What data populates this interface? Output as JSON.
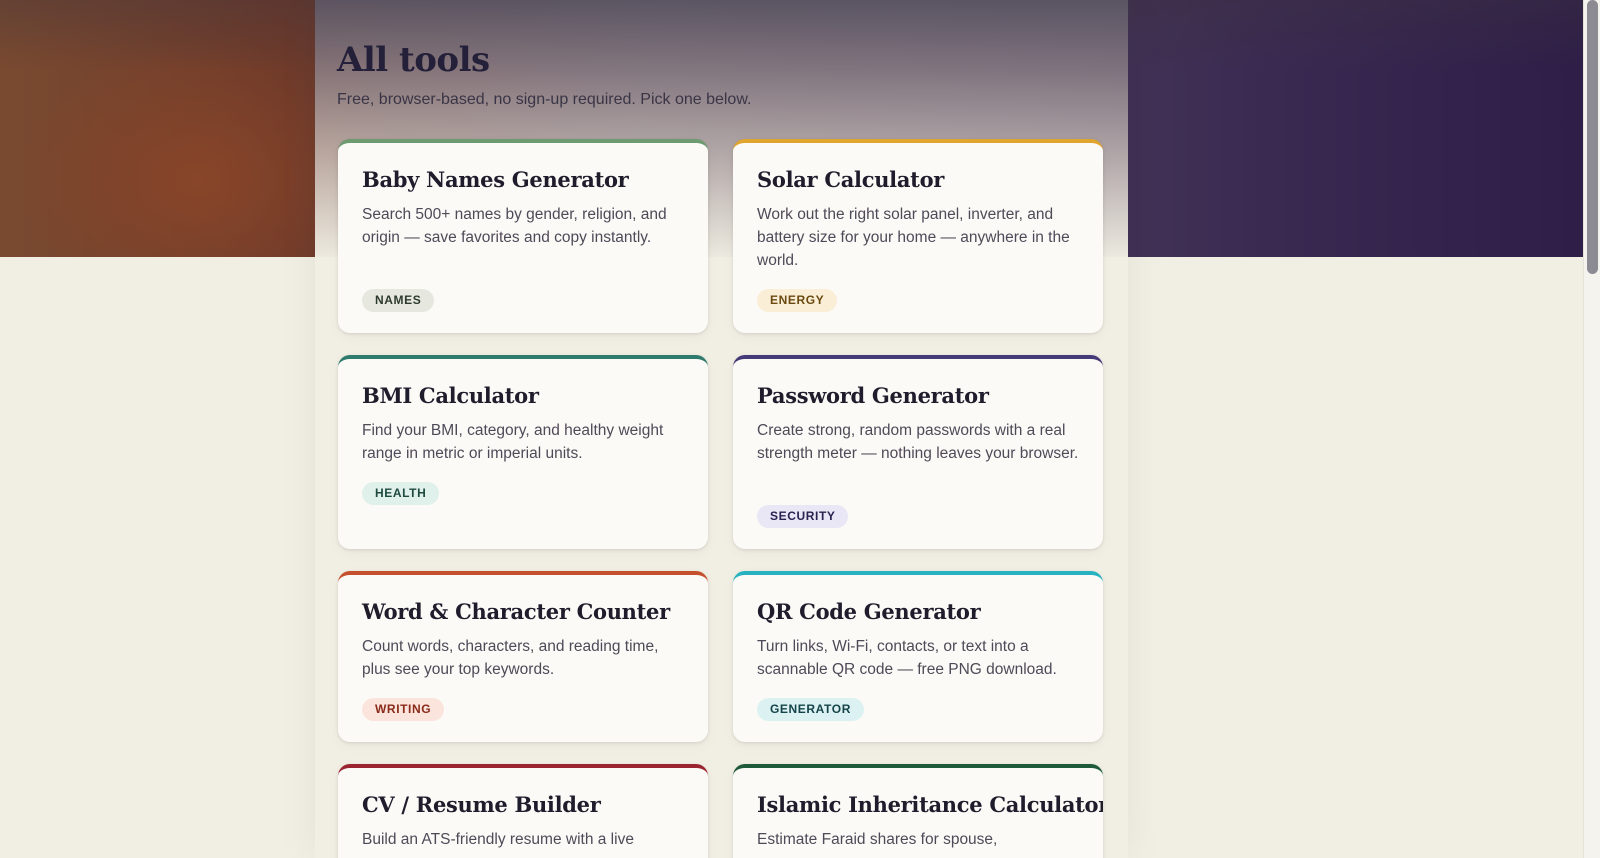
{
  "header": {
    "title": "All tools",
    "subtitle": "Free, browser-based, no sign-up required. Pick one below."
  },
  "tools": [
    {
      "title": "Baby Names Generator",
      "description": "Search 500+ names by gender, religion, and origin — save favorites and copy instantly.",
      "tag": "NAMES",
      "accent": "#6d9a70",
      "tag_bg": "#e6e8e0",
      "tag_color": "#2e3a2e"
    },
    {
      "title": "Solar Calculator",
      "description": "Work out the right solar panel, inverter, and battery size for your home — anywhere in the world.",
      "tag": "ENERGY",
      "accent": "#e0a52e",
      "tag_bg": "#fbeed6",
      "tag_color": "#6a4a10"
    },
    {
      "title": "BMI Calculator",
      "description": "Find your BMI, category, and healthy weight range in metric or imperial units.",
      "tag": "HEALTH",
      "accent": "#2e7a6c",
      "tag_bg": "#e0f0ea",
      "tag_color": "#1e4a40"
    },
    {
      "title": "Password Generator",
      "description": "Create strong, random passwords with a real strength meter — nothing leaves your browser.",
      "tag": "SECURITY",
      "accent": "#453a78",
      "tag_bg": "#e9e6f6",
      "tag_color": "#2a2250"
    },
    {
      "title": "Word & Character Counter",
      "description": "Count words, characters, and reading time, plus see your top keywords.",
      "tag": "WRITING",
      "accent": "#c4502e",
      "tag_bg": "#fbe4dc",
      "tag_color": "#8a2a18"
    },
    {
      "title": "QR Code Generator",
      "description": "Turn links, Wi-Fi, contacts, or text into a scannable QR code — free PNG download.",
      "tag": "GENERATOR",
      "accent": "#27b2c2",
      "tag_bg": "#dcf2f2",
      "tag_color": "#14444a"
    },
    {
      "title": "CV / Resume Builder",
      "description": "Build an ATS-friendly resume with a live",
      "tag": "",
      "accent": "#9a2430",
      "tag_bg": "#f6e0e0",
      "tag_color": "#6a1820"
    },
    {
      "title": "Islamic Inheritance Calculator",
      "description": "Estimate Faraid shares for spouse,",
      "tag": "",
      "accent": "#1e5a3a",
      "tag_bg": "#dcefe4",
      "tag_color": "#1e4a30"
    }
  ]
}
